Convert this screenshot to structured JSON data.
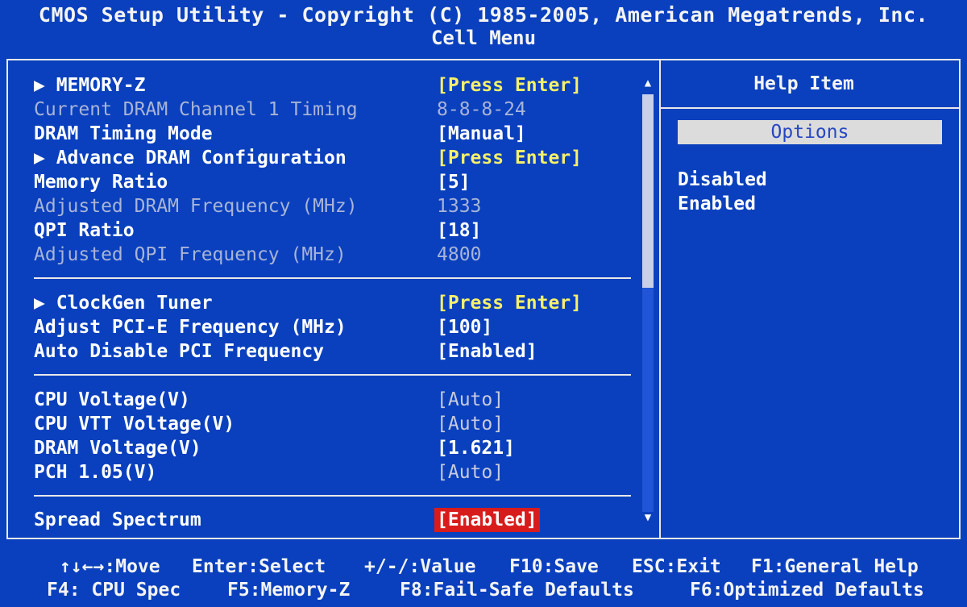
{
  "header": {
    "title": "CMOS Setup Utility - Copyright (C) 1985-2005, American Megatrends, Inc.",
    "menu": "Cell Menu"
  },
  "settings": [
    {
      "label": "▶ MEMORY-Z",
      "value": "[Press Enter]"
    },
    {
      "label": "Current DRAM Channel 1 Timing",
      "value": "8-8-8-24"
    },
    {
      "label": "DRAM Timing Mode",
      "value": "[Manual]"
    },
    {
      "label": "▶ Advance DRAM Configuration",
      "value": "[Press Enter]"
    },
    {
      "label": "Memory Ratio",
      "value": "[5]"
    },
    {
      "label": "Adjusted DRAM Frequency (MHz)",
      "value": "1333"
    },
    {
      "label": "QPI Ratio",
      "value": "[18]"
    },
    {
      "label": "Adjusted QPI Frequency (MHz)",
      "value": "4800"
    },
    {
      "label": "▶ ClockGen Tuner",
      "value": "[Press Enter]"
    },
    {
      "label": "Adjust PCI-E Frequency (MHz)",
      "value": "[100]"
    },
    {
      "label": "Auto Disable PCI Frequency",
      "value": "[Enabled]"
    },
    {
      "label": "CPU Voltage(V)",
      "value": "[Auto]"
    },
    {
      "label": "CPU VTT Voltage(V)",
      "value": "[Auto]"
    },
    {
      "label": "DRAM Voltage(V)",
      "value": "[1.621]"
    },
    {
      "label": "PCH 1.05(V)",
      "value": "[Auto]"
    },
    {
      "label": "Spread Spectrum",
      "value": "[Enabled]"
    }
  ],
  "help": {
    "title": "Help Item",
    "options_label": "Options",
    "options": [
      "Disabled",
      "Enabled"
    ]
  },
  "scrollbar": {
    "up": "▲",
    "down": "▼"
  },
  "footer": {
    "move": "↑↓←→:Move",
    "select": "Enter:Select",
    "value": "+/-/:Value",
    "save": "F10:Save",
    "exit": "ESC:Exit",
    "general_help": "F1:General Help",
    "cpu_spec": "F4: CPU Spec",
    "memory_z": "F5:Memory-Z",
    "failsafe": "F8:Fail-Safe Defaults",
    "optimized": "F6:Optimized Defaults"
  },
  "colors": {
    "background": "#0a40bd",
    "highlight": "#d81c1c",
    "submenu_value": "#f6f06a",
    "disabled_text": "#a8b4d8"
  }
}
